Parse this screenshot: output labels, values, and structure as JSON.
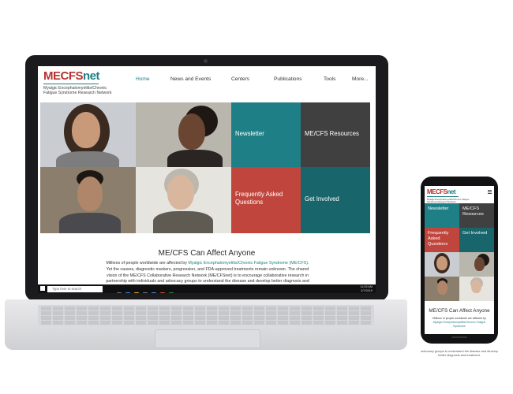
{
  "logo": {
    "me": "ME",
    "cfs": "CFS",
    "net": "net",
    "subtitle": "Myalgic Encephalomyelitis/Chronic Fatigue Syndrome Research Network"
  },
  "nav": {
    "items": [
      {
        "label": "Home",
        "active": true
      },
      {
        "label": "News and Events",
        "active": false
      },
      {
        "label": "Centers",
        "active": false
      },
      {
        "label": "Publications",
        "active": false
      },
      {
        "label": "Tools",
        "active": false
      },
      {
        "label": "More...",
        "active": false
      }
    ]
  },
  "tiles": {
    "newsletter": "Newsletter",
    "resources": "ME/CFS Resources",
    "faq": "Frequently Asked Questions",
    "get_involved": "Get Involved"
  },
  "colors": {
    "teal": "#1e7f86",
    "dark_gray": "#404040",
    "red": "#c0463d",
    "dark_teal": "#18656b"
  },
  "main": {
    "heading": "ME/CFS Can Affect Anyone",
    "body_intro": "Millions of people worldwide are affected by ",
    "body_link": "Myalgic Encephalomyelitis/Chronic Fatigue Syndrome (ME/CFS)",
    "body_rest": ". Yet the causes, diagnostic markers, progression, and FDA-approved treatments remain unknown. The shared vision of the ME/CFS Collaborative Research Network (ME/CFSnet) is to encourage collaborative research in partnership with individuals and advocacy groups to understand the disease and develop better diagnosis and"
  },
  "taskbar": {
    "search_placeholder": "Type here to search",
    "time": "11:03 AM",
    "date": "2/7/2019"
  },
  "phone": {
    "tiles": {
      "newsletter": "Newsletter",
      "resources": "ME/CFS Resources",
      "faq": "Frequently Asked Questions",
      "get_involved": "Get Involved"
    },
    "heading": "ME/CFS Can Affect Anyone",
    "body_intro": "Millions of people worldwide are affected by",
    "body_link": "Myalgic Encephalomyelitis/Chronic Fatigue Syndrome",
    "below_text": "advocacy groups to understand the disease and develop better diagnosis and treatment."
  }
}
